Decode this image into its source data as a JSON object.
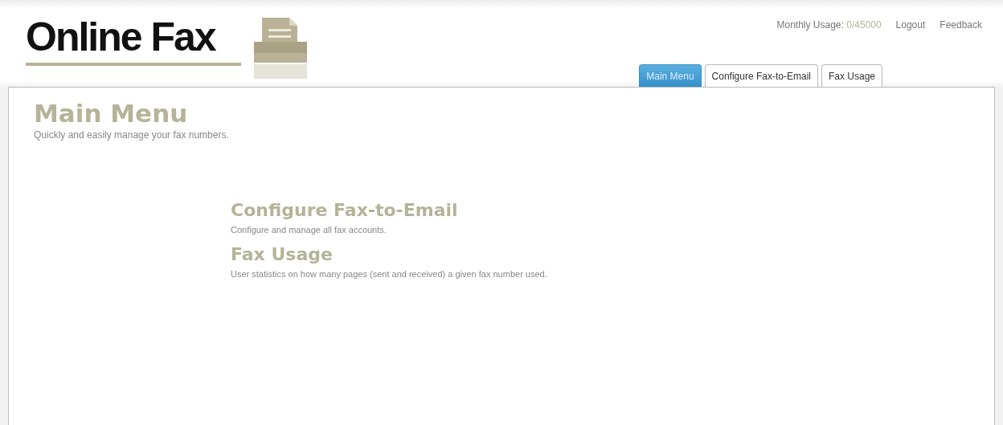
{
  "logo": {
    "text": "Online Fax"
  },
  "top_links": {
    "usage_label": "Monthly Usage:",
    "usage_value": "0/45000",
    "links": [
      "Logout",
      "Feedback"
    ]
  },
  "tabs": [
    {
      "label": "Main Menu",
      "selected": true
    },
    {
      "label": "Configure Fax-to-Email",
      "selected": false
    },
    {
      "label": "Fax Usage",
      "selected": false
    }
  ],
  "page": {
    "title": "Main Menu",
    "subtitle": "Quickly and easily manage your fax numbers."
  },
  "menu_items": [
    {
      "title": "Configure Fax-to-Email",
      "description": "Configure and manage all fax accounts."
    },
    {
      "title": "Fax Usage",
      "description": "User statistics on how many pages (sent and received) a given fax number used."
    }
  ]
}
